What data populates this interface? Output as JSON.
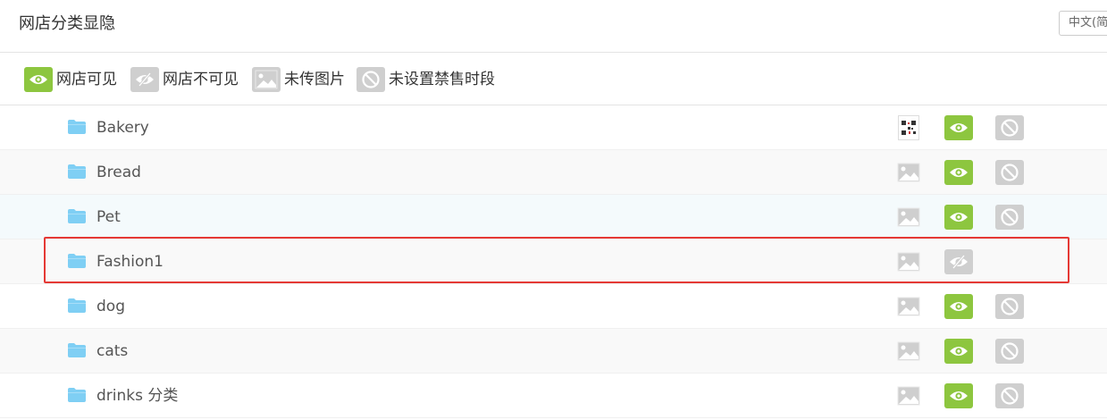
{
  "header": {
    "title": "网店分类显隐",
    "language": "中文(简"
  },
  "legend": [
    {
      "icon": "eye-icon",
      "label": "网店可见",
      "color": "#8dc63f"
    },
    {
      "icon": "eye-slash-icon",
      "label": "网店不可见",
      "color": "#cfcfcf"
    },
    {
      "icon": "image-placeholder-icon",
      "label": "未传图片",
      "color": "#cfcfcf"
    },
    {
      "icon": "ban-icon",
      "label": "未设置禁售时段",
      "color": "#cfcfcf"
    }
  ],
  "categories": [
    {
      "name": "Bakery",
      "image": "qr-thumbnail",
      "visible": true,
      "ban": true
    },
    {
      "name": "Bread",
      "image": "placeholder",
      "visible": true,
      "ban": true
    },
    {
      "name": "Pet",
      "image": "placeholder",
      "visible": true,
      "ban": true
    },
    {
      "name": "Fashion1",
      "image": "placeholder",
      "visible": false,
      "ban": false
    },
    {
      "name": "dog",
      "image": "placeholder",
      "visible": true,
      "ban": true
    },
    {
      "name": "cats",
      "image": "placeholder",
      "visible": true,
      "ban": true
    },
    {
      "name": "drinks 分类",
      "image": "placeholder",
      "visible": true,
      "ban": true
    }
  ],
  "colors": {
    "visible": "#8dc63f",
    "inactive": "#cfcfcf",
    "folder": "#7fcff4",
    "highlight": "#e53935"
  }
}
